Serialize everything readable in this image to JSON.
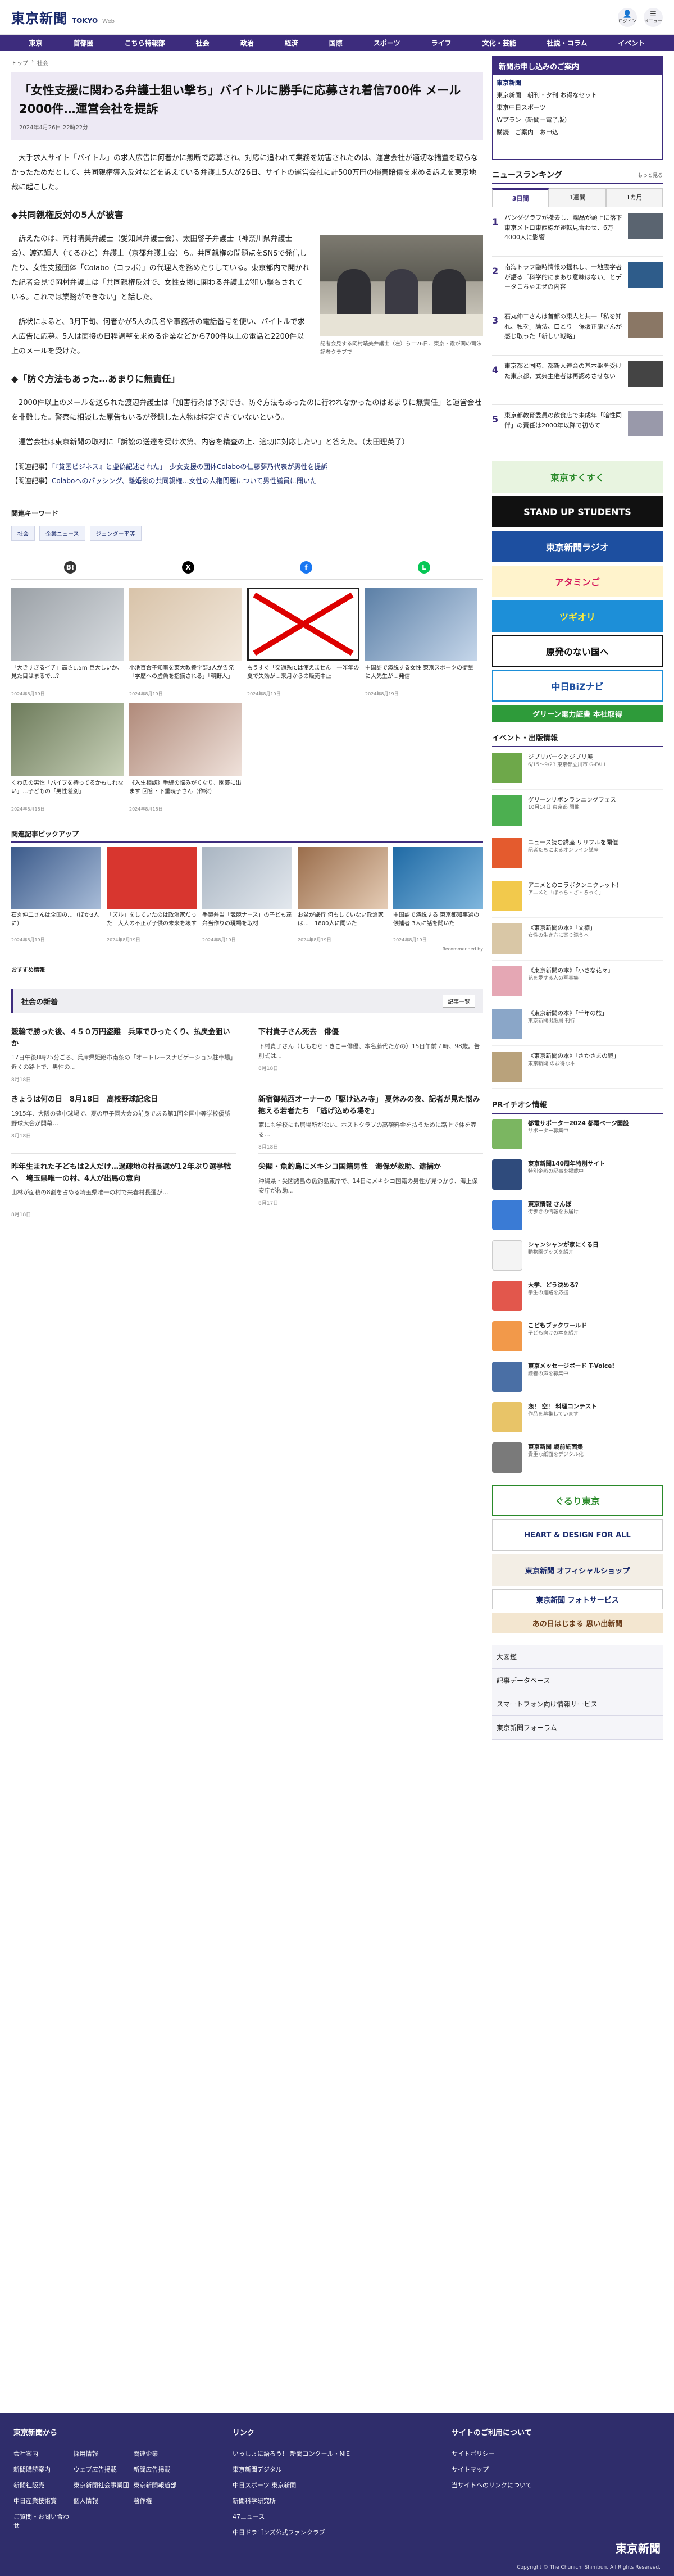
{
  "header": {
    "logo": "東京新聞",
    "logo_sub": "TOKYO",
    "logo_web": "Web",
    "login_label": "ログイン",
    "menu_label": "メニュー"
  },
  "nav": [
    "東京",
    "首都圏",
    "こちら特報部",
    "社会",
    "政治",
    "経済",
    "国際",
    "スポーツ",
    "ライフ",
    "文化・芸能",
    "社説・コラム",
    "イベント"
  ],
  "article": {
    "breadcrumb": [
      "トップ",
      "社会"
    ],
    "headline": "「女性支援に関わる弁護士狙い撃ち」バイトルに勝手に応募され着信700件 メール2000件…運営会社を提訴",
    "date": "2024年4月26日 22時22分",
    "lead": "大手求人サイト「バイトル」の求人広告に何者かに無断で応募され、対応に追われて業務を妨害されたのは、運営会社が適切な措置を取らなかったためだとして、共同親権導入反対などを訴えている弁護士5人が26日、サイトの運営会社に計500万円の損害賠償を求める訴えを東京地裁に起こした。",
    "sub1": "◆共同親権反対の5人が被害",
    "p1": "訴えたのは、岡村晴美弁護士（愛知県弁護士会）、太田啓子弁護士（神奈川県弁護士会）、渡辺輝人（てるひと）弁護士（京都弁護士会）ら。共同親権の問題点をSNSで発信したり、女性支援団体「Colabo（コラボ）」の代理人を務めたりしている。東京都内で開かれた記者会見で岡村弁護士は「共同親権反対で、女性支援に関わる弁護士が狙い撃ちされている。これでは業務ができない」と話した。",
    "p2": "訴状によると、3月下旬、何者かが5人の氏名や事務所の電話番号を使い、バイトルで求人広告に応募。5人は面接の日程調整を求める企業などから700件以上の電話と2200件以上のメールを受けた。",
    "sub2": "◆「防ぐ方法もあった…あまりに無責任」",
    "p3": "2000件以上のメールを送られた渡辺弁護士は「加害行為は予測でき、防ぐ方法もあったのに行われなかったのはあまりに無責任」と運営会社を非難した。警察に相談した原告もいるが登録した人物は特定できていないという。",
    "p4": "運営会社は東京新聞の取材に「訴訟の送達を受け次第、内容を精査の上、適切に対応したい」と答えた。（太田理英子）",
    "caption": "記者会見する岡村晴美弁護士（左）ら＝26日、東京・霞が関の司法記者クラブで",
    "related": [
      {
        "prefix": "【関連記事】",
        "text": "「『貧困ビジネス』と虚偽記述された」　少女支援の団体Colaboの仁藤夢乃代表が男性を提訴"
      },
      {
        "prefix": "【関連記事】",
        "text": "Colaboへのバッシング、離婚後の共同親権…女性の人権問題について男性議員に聞いた"
      }
    ]
  },
  "keywords": {
    "label": "関連キーワード",
    "items": [
      "社会",
      "企業ニュース",
      "ジェンダー平等"
    ]
  },
  "related_cards": [
    {
      "title": "「大きすぎるイチ」高さ1.5m 巨大しいか、見た目はまるで…？",
      "date": "2024年8月19日"
    },
    {
      "title": "小池百合子知事を東大教養学部3人が告発「学歴への虚偽を指摘される」「朝野人」",
      "date": "2024年8月19日"
    },
    {
      "title": "もうすぐ「交通系ICは使えません」一昨年の夏で失効が…来月からの販売中止",
      "date": "2024年8月19日"
    },
    {
      "title": "中国語で演説する女性 東京スポーツの衝撃に大先生が…発信",
      "date": "2024年8月19日"
    },
    {
      "title": "くわ氏の男性「パイプを持ってるかもしれない」…子どもの「男性差別」",
      "date": "2024年8月18日"
    },
    {
      "title": "《入生相談》手編の悩みがくなり、園芸に出ます 回答・下重暁子さん（作家）",
      "date": "2024年8月18日"
    }
  ],
  "pickup": {
    "title": "関連記事ピックアップ",
    "items": [
      {
        "title": "石丸伸二さんは全国の…（ほか3人に）",
        "date": "2024年8月19日"
      },
      {
        "title": "「ズル」をしていたのは政治家だった　大人の不正が子供の未来を壊す",
        "date": "2024年8月19日"
      },
      {
        "title": "手製弁当「競競ナース」の子ども達 弁当作りの現場を取材",
        "date": "2024年8月19日"
      },
      {
        "title": "お盆が旅行 何もしていない政治家は…　1800人に聞いた",
        "date": "2024年8月19日"
      },
      {
        "title": "中国語で演説する 東京都知事選の候補者 3人に話を聞いた",
        "date": "2024年8月19日"
      }
    ],
    "recommended": "Recommended by"
  },
  "osusume": "おすすめ情報",
  "social": {
    "title": "社会の新着",
    "more": "記事一覧",
    "items": [
      {
        "h": "競輪で勝った後、４５０万円盗難　兵庫でひったくり、払戻金狙いか",
        "b": "17日午後8時25分ごろ、兵庫県姫路市南条の「オートレースナビゲーション駐車場」近くの路上で、男性の…",
        "d": "8月18日"
      },
      {
        "h": "下村貴子さん死去　俳優",
        "b": "下村貴子さん（しもむら・きこ＝俳優、本名藤代たかの）15日午前７時、98歳。告別式は…",
        "d": "8月18日"
      },
      {
        "h": "きょうは何の日　8月18日　高校野球記念日",
        "b": "1915年、大阪の豊中球場で、夏の甲子園大会の前身である第1回全国中等学校優勝野球大会が開幕…",
        "d": "8月18日"
      },
      {
        "h": "新宿御苑西オーナーの「駆け込み寺」 夏休みの夜、記者が見た悩み抱える若者たち　「逃げ込める場を」",
        "b": "家にも学校にも居場所がない。ホストクラブの高額料金を払うために路上で体を売る…",
        "d": "8月18日"
      },
      {
        "h": "昨年生まれた子どもは2人だけ…過疎地の村長選が12年ぶり選挙戦へ　埼玉県唯一の村、4人が出馬の意向",
        "b": "山林が面積の8割を占める埼玉県唯一の村で来春村長選が…",
        "d": "8月18日"
      },
      {
        "h": "尖閣・魚釣島にメキシコ国籍男性　海保が救助、逮捕か",
        "b": "沖縄県・尖閣諸島の魚釣島東岸で、14日にメキシコ国籍の男性が見つかり、海上保安庁が救助…",
        "d": "8月17日"
      }
    ]
  },
  "side": {
    "promo": {
      "title": "新聞お申し込みのご案内",
      "rows": [
        "東京新聞　朝刊・夕刊 お得なセット",
        "東京中日スポーツ",
        "Wプラン（新聞＋電子版）",
        "購読　ご案内　お申込"
      ]
    },
    "ranking": {
      "title": "ニュースランキング",
      "more": "もっと見る",
      "tabs": [
        "3日間",
        "1週間",
        "1カ月"
      ],
      "items": [
        "パンダグラフが撤去し、課品が頭上に落下 東京メトロ東西線が運転見合わせ、6万4000人に影響",
        "南海トラフ臨時情報の揺れし、一地震学者が語る「科学的にまあり意味はない」とデータこちゃまぜの内容",
        "石丸伸二さんは首都の東人と共一「私を知れ、私を」論法、口とり　保坂正康さんが感じ取った「新しい戦略」",
        "東京都と同時、都新人連会の基本盤を受けた東京都、式典主催者は再認めさせない",
        "東京都教育委員の飲食店で未成年「暗性同伴」の責任は2000年以降で初めて"
      ]
    },
    "banners": [
      "東京すくすく",
      "STAND UP STUDENTS",
      "東京新聞ラジオ",
      "アタミンご",
      "ツギオリ",
      "原発のない国へ",
      "中日BiZナビ",
      "グリーン電力証書 本社取得"
    ],
    "events": {
      "title": "イベント・出版情報",
      "items": [
        {
          "t": "ジブリパークとジブリ展",
          "s": "6/15〜9/23 東京都立川市 G-FALL"
        },
        {
          "t": "グリーンリボンランニングフェス",
          "s": "10月14日 東京都 開催"
        },
        {
          "t": "ニュース読む講座 リリフルを開催",
          "s": "記者たちによるオンライン講座"
        },
        {
          "t": "アニメとのコラボタンニクレット！",
          "s": "アニメと「ぼっち・ざ・ろっく」"
        },
        {
          "t": "《東京新聞の本》「文様」",
          "s": "女性の生き方に寄り添う本"
        },
        {
          "t": "《東京新聞の本》「小さな花々」",
          "s": "花を愛する人の写真集"
        },
        {
          "t": "《東京新聞の本》「千年の旅」",
          "s": "東京新聞出版局 刊行"
        },
        {
          "t": "《東京新聞の本》「さかさまの鏡」",
          "s": "東京新聞 のお得な本"
        }
      ]
    },
    "pr": {
      "title": "PRイチオシ情報",
      "items": [
        {
          "b": "都電サポーター2024 都電ページ開設",
          "s": "サポーター募集中"
        },
        {
          "b": "東京新聞140周年特別サイト",
          "s": "特別企画の記事を掲載中"
        },
        {
          "b": "東京情報 さんぽ",
          "s": "街歩きの情報をお届け"
        },
        {
          "b": "シャンシャンが家にくる日",
          "s": "動物園グッズを紹介"
        },
        {
          "b": "大学、どう決める？",
          "s": "学生の進路を応援"
        },
        {
          "b": "こどもブックワールド",
          "s": "子ども向けの本を紹介"
        },
        {
          "b": "東京メッセージボード T-Voice!",
          "s": "読者の声を募集中"
        },
        {
          "b": "恋！ 空！ 料理コンテスト",
          "s": "作品を募集しています"
        },
        {
          "b": "東京新聞 戦前紙面集",
          "s": "貴重な紙面をデジタル化"
        }
      ]
    },
    "ad_banners": [
      "ぐるり東京",
      "HEART & DESIGN FOR ALL",
      "東京新聞 オフィシャルショップ",
      "東京新聞 フォトサービス",
      "あの日はじまる 思い出新聞"
    ],
    "list": [
      "大図鑑",
      "記事データベース",
      "スマートフォン向け情報サービス",
      "東京新聞フォーラム"
    ]
  },
  "footer": {
    "col1": {
      "title": "東京新聞から",
      "links": [
        "会社案内",
        "採用情報",
        "関連企業",
        "新聞購読案内",
        "ウェブ広告掲載",
        "新聞広告掲載",
        "新聞社販売",
        "東京新聞社会事業団",
        "東京新聞報道部",
        "中日産業技術賞",
        "個人情報",
        "著作権",
        "ご質問・お問い合わせ"
      ]
    },
    "col2": {
      "title": "リンク",
      "links": [
        "いっしょに語ろう！ 新聞コンクール・NIE",
        "東京新聞デジタル",
        "中日スポーツ 東京新聞",
        "新聞科学研究所",
        "47ニュース",
        "中日ドラゴンズ公式ファンクラブ"
      ]
    },
    "col3": {
      "title": "サイトのご利用について",
      "links": [
        "サイトポリシー",
        "サイトマップ",
        "当サイトへのリンクについて"
      ]
    },
    "logo": "東京新聞",
    "copyright": "Copyright © The Chunichi Shimbun, All Rights Reserved."
  }
}
